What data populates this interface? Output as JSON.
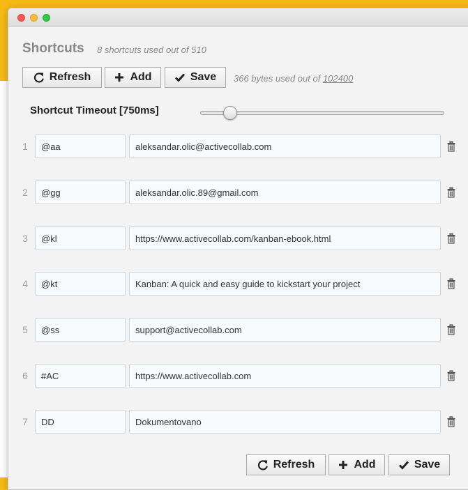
{
  "header": {
    "title": "Shortcuts",
    "subtitle": "8 shortcuts used out of 510"
  },
  "toolbar": {
    "refresh_label": "Refresh",
    "add_label": "Add",
    "save_label": "Save",
    "bytes_prefix": "366 bytes used out of ",
    "bytes_limit": "102400"
  },
  "timeout": {
    "label": "Shortcut Timeout [750ms]",
    "value_ms": 750,
    "level_fraction": 0.1
  },
  "rows": [
    {
      "num": "1",
      "key": "@aa",
      "value": "aleksandar.olic@activecollab.com"
    },
    {
      "num": "2",
      "key": "@gg",
      "value": "aleksandar.olic.89@gmail.com"
    },
    {
      "num": "3",
      "key": "@kl",
      "value": "https://www.activecollab.com/kanban-ebook.html"
    },
    {
      "num": "4",
      "key": "@kt",
      "value": "Kanban: A quick and easy guide to kickstart your project"
    },
    {
      "num": "5",
      "key": "@ss",
      "value": "support@activecollab.com"
    },
    {
      "num": "6",
      "key": "#AC",
      "value": "https://www.activecollab.com"
    },
    {
      "num": "7",
      "key": "DD",
      "value": "Dokumentovano"
    }
  ],
  "icons": {
    "refresh": "refresh-icon",
    "add": "plus-icon",
    "save": "check-icon",
    "delete": "trash-icon"
  },
  "colors": {
    "accent_background": "#f7b916",
    "muted_text": "#888888",
    "field_background": "#f7fbfe"
  }
}
